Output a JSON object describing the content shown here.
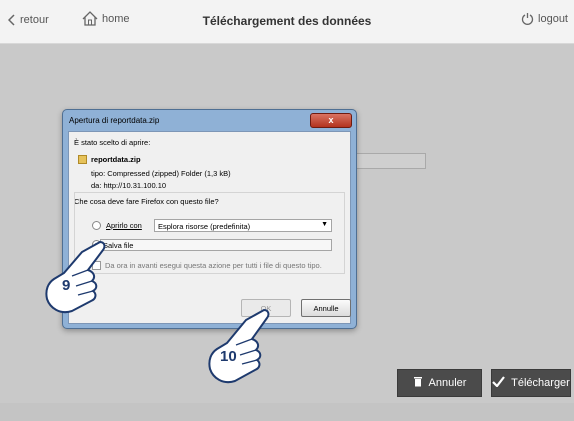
{
  "topbar": {
    "back_label": "retour",
    "home_label": "home",
    "title": "Téléchargement des données",
    "logout_label": "logout"
  },
  "dialog": {
    "title": "Apertura di reportdata.zip",
    "intro": "È stato scelto di aprire:",
    "filename": "reportdata.zip",
    "type_line": "tipo: Compressed (zipped) Folder (1,3 kB)",
    "from_line": "da: http://10.31.100.10",
    "question": "Che cosa deve fare Firefox con questo file?",
    "open_with_label": "Aprirlo con",
    "open_with_value": "Esplora risorse (predefinita)",
    "save_label": "Salva file",
    "remember_label": "Da ora in avanti esegui questa azione per tutti i file di questo tipo.",
    "ok_label": "OK",
    "cancel_label": "Annulle"
  },
  "actions": {
    "cancel_label": "Annuler",
    "download_label": "Télécharger"
  },
  "callouts": {
    "step_a": "9",
    "step_b": "10"
  },
  "icons": [
    "chevron-left-icon",
    "home-icon",
    "power-icon",
    "trash-icon",
    "check-icon",
    "close-icon",
    "zip-file-icon",
    "hand-pointer-icon"
  ]
}
